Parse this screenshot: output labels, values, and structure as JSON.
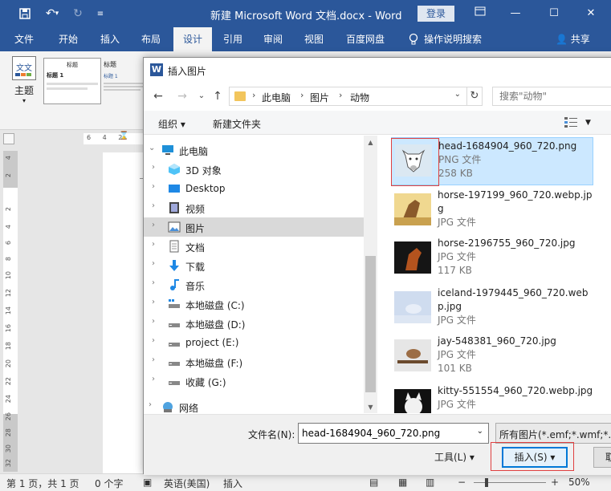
{
  "window": {
    "title": "新建 Microsoft Word 文档.docx - Word",
    "login": "登录"
  },
  "tabs": [
    {
      "label": "文件"
    },
    {
      "label": "开始"
    },
    {
      "label": "插入"
    },
    {
      "label": "布局"
    },
    {
      "label": "设计"
    },
    {
      "label": "引用"
    },
    {
      "label": "审阅"
    },
    {
      "label": "视图"
    },
    {
      "label": "百度网盘"
    },
    {
      "label": "操作说明搜索"
    }
  ],
  "share": "共享",
  "ribbon": {
    "theme_label": "主题",
    "gallery": [
      {
        "title": "标题",
        "heading": "标题 1"
      },
      {
        "title": "标题",
        "heading": "标题 1"
      }
    ]
  },
  "ruler_h": "6 4 2",
  "ruler_v": [
    "4",
    "2",
    "2",
    "4",
    "6",
    "8",
    "10",
    "12",
    "14",
    "16",
    "18",
    "20",
    "22",
    "24",
    "26",
    "28",
    "30",
    "32"
  ],
  "status": {
    "page": "第 1 页，共 1 页",
    "words": "0 个字",
    "lang": "英语(美国)",
    "mode": "插入",
    "zoom": "50%"
  },
  "dialog": {
    "title": "插入图片",
    "breadcrumbs": [
      "此电脑",
      "图片",
      "动物"
    ],
    "search_placeholder": "搜索\"动物\"",
    "organize": "组织 ▾",
    "new_folder": "新建文件夹",
    "nav": [
      {
        "label": "此电脑",
        "icon": "pc-icon",
        "root": true
      },
      {
        "label": "3D 对象",
        "icon": "cube-icon"
      },
      {
        "label": "Desktop",
        "icon": "desktop-icon"
      },
      {
        "label": "视频",
        "icon": "video-icon"
      },
      {
        "label": "图片",
        "icon": "pictures-icon",
        "selected": true
      },
      {
        "label": "文档",
        "icon": "document-icon"
      },
      {
        "label": "下载",
        "icon": "download-icon"
      },
      {
        "label": "音乐",
        "icon": "music-icon"
      },
      {
        "label": "本地磁盘 (C:)",
        "icon": "drive-icon"
      },
      {
        "label": "本地磁盘 (D:)",
        "icon": "drive-icon"
      },
      {
        "label": "project (E:)",
        "icon": "drive-icon"
      },
      {
        "label": "本地磁盘 (F:)",
        "icon": "drive-icon"
      },
      {
        "label": "收藏 (G:)",
        "icon": "drive-icon"
      },
      {
        "label": "网络",
        "icon": "network-icon",
        "root": true
      }
    ],
    "files": [
      {
        "name": "head-1684904_960_720.png",
        "type": "PNG 文件",
        "size": "258 KB",
        "selected": true
      },
      {
        "name": "horse-197199_960_720.webp.jpg",
        "type": "JPG 文件",
        "size": ""
      },
      {
        "name": "horse-2196755_960_720.jpg",
        "type": "JPG 文件",
        "size": "117 KB"
      },
      {
        "name": "iceland-1979445_960_720.webp.jpg",
        "type": "JPG 文件",
        "size": ""
      },
      {
        "name": "jay-548381_960_720.jpg",
        "type": "JPG 文件",
        "size": "101 KB"
      },
      {
        "name": "kitty-551554_960_720.webp.jpg",
        "type": "JPG 文件",
        "size": ""
      }
    ],
    "filename_label": "文件名(N):",
    "filename_value": "head-1684904_960_720.png",
    "filetype": "所有图片(*.emf;*.wmf;*.jpg",
    "tools": "工具(L) ▾",
    "insert": "插入(S) ▾",
    "cancel": "取消"
  },
  "colors": {
    "word_blue": "#2b579a",
    "selected_file": "#cce8ff",
    "highlight_red": "#e04040"
  }
}
